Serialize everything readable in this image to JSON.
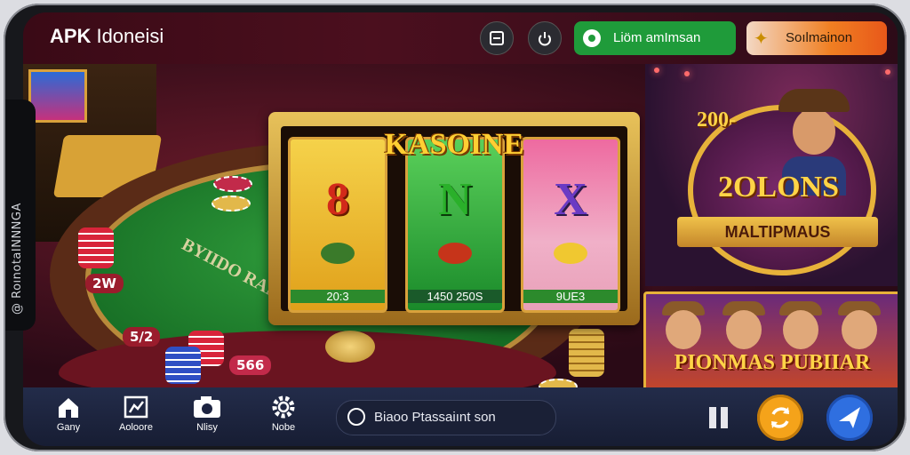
{
  "header": {
    "brand_apk": "APK",
    "brand_name": "Idoneisi",
    "download_label": "Liöm amImsan",
    "promo_label": "Soılmainon"
  },
  "side_label": "@ RoınotaINNNGA",
  "slot": {
    "title": "KASOINE",
    "reels": [
      {
        "symbol": "8",
        "prize": "20:3"
      },
      {
        "symbol": "N",
        "prize": "1450 250S"
      },
      {
        "symbol": "X",
        "prize": "9UE3"
      }
    ]
  },
  "table": {
    "felt_text": "BYIIDO RANNOO",
    "labels": [
      "2W",
      "5/2",
      "566"
    ]
  },
  "promo": {
    "amount": "200-",
    "title": "2OLONS",
    "subtitle": "MALTIPMAUS"
  },
  "card": {
    "title": "PIONMAS PUBIIAR"
  },
  "bottom_nav": {
    "items": [
      {
        "label": "Gany"
      },
      {
        "label": "Aoloore"
      },
      {
        "label": "Nlisy"
      },
      {
        "label": "Nobe"
      }
    ],
    "search_placeholder": "Biaoo Ptassaiınt son"
  },
  "colors": {
    "accent_green": "#1f9b3a",
    "accent_orange": "#f07f22",
    "nav_bg": "#1c2340",
    "gold": "#e7b23a"
  },
  "icons": [
    "menu-icon",
    "power-icon",
    "home-icon",
    "chart-icon",
    "camera-icon",
    "settings-icon",
    "search-icon",
    "pause-icon",
    "refresh-icon",
    "send-icon"
  ]
}
